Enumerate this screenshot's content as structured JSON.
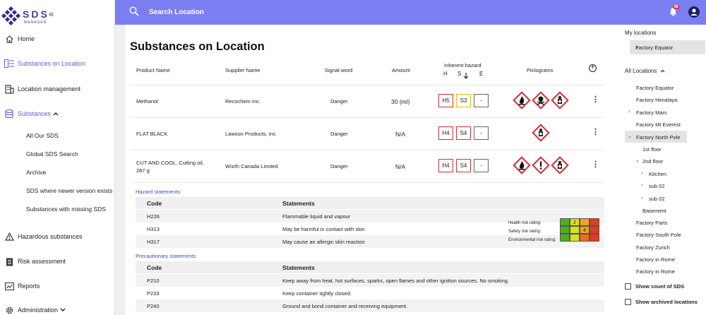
{
  "brand": {
    "name": "SDS",
    "tagline": "MANAGER",
    "collapse_icon": "«"
  },
  "sidebar": {
    "items": [
      {
        "label": "Home",
        "icon": "home-icon"
      },
      {
        "label": "Substances on Location",
        "icon": "list-icon",
        "active": true
      },
      {
        "label": "Location management",
        "icon": "building-icon"
      },
      {
        "label": "Substances",
        "icon": "database-icon",
        "expanded": true
      }
    ],
    "sub_items": [
      "All Our SDS",
      "Global SDS Search",
      "Archive",
      "SDS where newer version exists",
      "Substances with missing SDS"
    ],
    "bottom_items": [
      {
        "label": "Hazardous substances",
        "icon": "warning-icon"
      },
      {
        "label": "Risk assessment",
        "icon": "clipboard-icon"
      },
      {
        "label": "Reports",
        "icon": "report-icon"
      },
      {
        "label": "Administration",
        "icon": "gear-icon"
      }
    ]
  },
  "header": {
    "search_label": "Search Location",
    "notification_count": "88"
  },
  "main": {
    "title": "Substances on Location",
    "columns": {
      "product": "Product Name",
      "supplier": "Supplier Name",
      "signal": "Signal word",
      "amount": "Amount",
      "hazard": "Inherent hazard",
      "h": "H",
      "s": "S",
      "e": "E",
      "pictograms": "Pictograms"
    },
    "rows": [
      {
        "product": "Methanol",
        "supplier": "Recochem Inc.",
        "signal": "Danger",
        "amount": "30 (ml)",
        "h": "H5",
        "s": "S3",
        "e": "-",
        "pictograms": [
          "flame",
          "skull",
          "health-hazard"
        ]
      },
      {
        "product": "FLAT BLACK",
        "supplier": "Lawson Products, Inc",
        "signal": "Danger",
        "amount": "N/A",
        "h": "H4",
        "s": "S4",
        "e": "-",
        "pictograms": [
          "health-hazard"
        ]
      },
      {
        "product": "CUT AND COOL, Cutting oil, 287 g",
        "supplier": "Würth Canada Limited",
        "signal": "Danger",
        "amount": "N/A",
        "h": "H4",
        "s": "S4",
        "e": "-",
        "pictograms": [
          "flame",
          "exclamation",
          "health-hazard"
        ]
      }
    ],
    "hazard_section": {
      "title": "Hazard statements:",
      "code_header": "Code",
      "statement_header": "Statements",
      "rows": [
        {
          "code": "H226",
          "statement": "Flammable liquid and vapour"
        },
        {
          "code": "H313",
          "statement": "May be harmful in contact with skin"
        },
        {
          "code": "H317",
          "statement": "May cause an allergic skin reaction"
        }
      ]
    },
    "risk": {
      "labels": [
        "Health risk rating:",
        "Safety risk rating:",
        "Environmental risk rating:"
      ],
      "health_value": "2",
      "safety_value": "4",
      "colors": [
        "#4caf1f",
        "#d6e21e",
        "#f6a21a",
        "#ef6c1e",
        "#e53b1f"
      ]
    },
    "precaution_section": {
      "title": "Precautionary statements:",
      "code_header": "Code",
      "statement_header": "Statements",
      "rows": [
        {
          "code": "P210",
          "statement": "Keep away from heat, hot surfaces, sparks, open flames and other ignition sources. No smoking."
        },
        {
          "code": "P233",
          "statement": "Keep container tightly closed."
        },
        {
          "code": "P240",
          "statement": "Ground and bond container and receiving equipment."
        }
      ]
    }
  },
  "right_panel": {
    "my_locations_title": "My locations",
    "favorite": "Factory Equator",
    "all_locations_title": "All Locations",
    "locations": {
      "equator": "Factory Equator",
      "himalaya": "Factory Himalaya",
      "mars": "Factory Mars",
      "everest": "Factory Mt Everest",
      "north_pole": "Factory North Pole",
      "floor1": "1st floor",
      "floor2": "2nd floor",
      "kitchen": "Kitchen",
      "sub02a": "sub 02",
      "sub02b": "sub 02",
      "basement": "Basement",
      "paris": "Factory Paris",
      "south_pole": "Factory South Pole",
      "zurich": "Factory Zurich",
      "rome1": "Factory in Rome",
      "rome2": "Factory in Rome"
    },
    "show_count": "Show count of SDS",
    "show_archived": "Show archived locations"
  }
}
